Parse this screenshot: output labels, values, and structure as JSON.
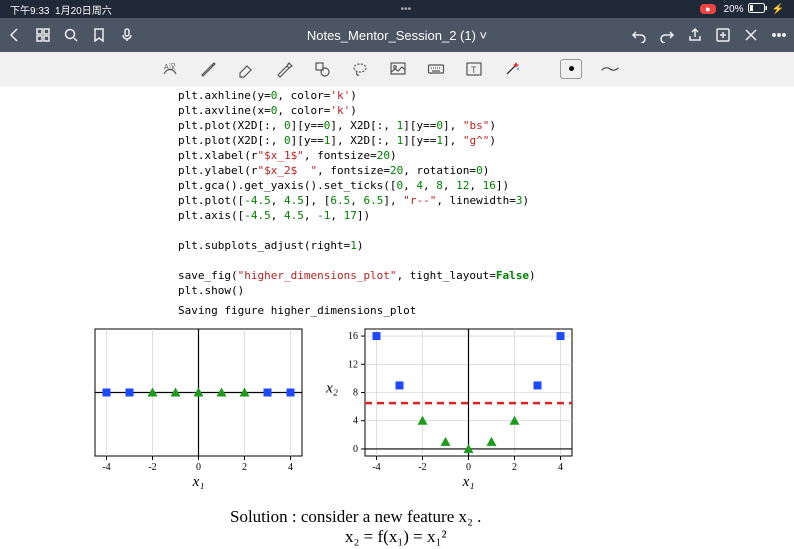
{
  "status": {
    "time": "下午9:33",
    "date": "1月20日周六",
    "center": "•••",
    "rec": "●",
    "wifi": "",
    "battery": "20%",
    "bolt": "⚡"
  },
  "titlebar": {
    "title": "Notes_Mentor_Session_2 (1) ˅"
  },
  "output": {
    "text": "Saving figure higher_dimensions_plot"
  },
  "code": {
    "l0a": "plt.axhline(y=",
    "l0n": "0",
    "l0b": ", color=",
    "l0s": "'k'",
    "l0c": ")",
    "l1a": "plt.axvline(x=",
    "l1n": "0",
    "l1b": ", color=",
    "l1s": "'k'",
    "l1c": ")",
    "l2a": "plt.plot(X2D[:, ",
    "l2n1": "0",
    "l2b": "][y==",
    "l2n2": "0",
    "l2c": "], X2D[:, ",
    "l2n3": "1",
    "l2d": "][y==",
    "l2n4": "0",
    "l2e": "], ",
    "l2s": "\"bs\"",
    "l2f": ")",
    "l3a": "plt.plot(X2D[:, ",
    "l3n1": "0",
    "l3b": "][y==",
    "l3n2": "1",
    "l3c": "], X2D[:, ",
    "l3n3": "1",
    "l3d": "][y==",
    "l3n4": "1",
    "l3e": "], ",
    "l3s": "\"g^\"",
    "l3f": ")",
    "l4a": "plt.xlabel(r",
    "l4s": "\"$x_1$\"",
    "l4b": ", fontsize=",
    "l4n": "20",
    "l4c": ")",
    "l5a": "plt.ylabel(r",
    "l5s": "\"$x_2$  \"",
    "l5b": ", fontsize=",
    "l5n1": "20",
    "l5c": ", rotation=",
    "l5n2": "0",
    "l5d": ")",
    "l6a": "plt.gca().get_yaxis().set_ticks([",
    "l6n1": "0",
    "l6c1": ", ",
    "l6n2": "4",
    "l6c2": ", ",
    "l6n3": "8",
    "l6c3": ", ",
    "l6n4": "12",
    "l6c4": ", ",
    "l6n5": "16",
    "l6b": "])",
    "l7a": "plt.plot([",
    "l7n1": "-4.5",
    "l7c1": ", ",
    "l7n2": "4.5",
    "l7b": "], [",
    "l7n3": "6.5",
    "l7c2": ", ",
    "l7n4": "6.5",
    "l7c": "], ",
    "l7s": "\"r--\"",
    "l7d": ", linewidth=",
    "l7n5": "3",
    "l7e": ")",
    "l8a": "plt.axis([",
    "l8n1": "-4.5",
    "l8c1": ", ",
    "l8n2": "4.5",
    "l8c2": ", ",
    "l8n3": "-1",
    "l8c3": ", ",
    "l8n4": "17",
    "l8b": "])",
    "l9": "",
    "l10a": "plt.subplots_adjust(right=",
    "l10n": "1",
    "l10b": ")",
    "l11": "",
    "l12a": "save_fig(",
    "l12s": "\"higher_dimensions_plot\"",
    "l12b": ", tight_layout=",
    "l12k": "False",
    "l12c": ")",
    "l13": "plt.show()"
  },
  "handwriting": {
    "line1": "Solution :   consider  a  new  feature  x₂ .",
    "line2": "x₂  =  f(x₁)  =  x₁²"
  },
  "chart_data": [
    {
      "type": "scatter",
      "title": "",
      "xlabel": "x₁",
      "ylabel": "",
      "xlim": [
        -4.5,
        4.5
      ],
      "ylim": [
        -1,
        1
      ],
      "xticks": [
        -4,
        -2,
        0,
        2,
        4
      ],
      "series": [
        {
          "name": "bs",
          "marker": "square",
          "color": "#1f49ff",
          "points": [
            [
              -4,
              0
            ],
            [
              -3,
              0
            ],
            [
              3,
              0
            ],
            [
              4,
              0
            ]
          ]
        },
        {
          "name": "g^",
          "marker": "triangle",
          "color": "#1c9b1c",
          "points": [
            [
              -2,
              0
            ],
            [
              -1,
              0
            ],
            [
              0,
              0
            ],
            [
              1,
              0
            ],
            [
              2,
              0
            ]
          ]
        }
      ],
      "axhline": 0,
      "axvline": 0
    },
    {
      "type": "scatter",
      "title": "",
      "xlabel": "x₁",
      "ylabel": "x₂",
      "xlim": [
        -4.5,
        4.5
      ],
      "ylim": [
        -1,
        17
      ],
      "xticks": [
        -4,
        -2,
        0,
        2,
        4
      ],
      "yticks": [
        0,
        4,
        8,
        12,
        16
      ],
      "series": [
        {
          "name": "bs",
          "marker": "square",
          "color": "#1f49ff",
          "points": [
            [
              -4,
              16
            ],
            [
              -3,
              9
            ],
            [
              3,
              9
            ],
            [
              4,
              16
            ]
          ]
        },
        {
          "name": "g^",
          "marker": "triangle",
          "color": "#1c9b1c",
          "points": [
            [
              -2,
              4
            ],
            [
              -1,
              1
            ],
            [
              0,
              0
            ],
            [
              1,
              1
            ],
            [
              2,
              4
            ]
          ]
        }
      ],
      "hline": {
        "y": 6.5,
        "style": "dashed",
        "color": "#d22"
      },
      "axhline": 0,
      "axvline": 0
    }
  ]
}
